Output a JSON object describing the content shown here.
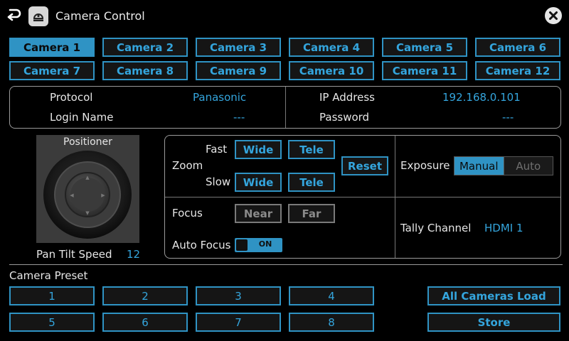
{
  "titlebar": {
    "title": "Camera Control",
    "back_icon": "return-arrow-icon",
    "app_icon": "camera-dome-icon",
    "close_icon": "close-icon"
  },
  "cameras": [
    "Camera 1",
    "Camera 2",
    "Camera 3",
    "Camera 4",
    "Camera 5",
    "Camera 6",
    "Camera 7",
    "Camera 8",
    "Camera 9",
    "Camera 10",
    "Camera 11",
    "Camera 12"
  ],
  "selected_camera": "Camera 1",
  "info": {
    "protocol_label": "Protocol",
    "protocol_value": "Panasonic",
    "ip_label": "IP Address",
    "ip_value": "192.168.0.101",
    "login_label": "Login Name",
    "login_value": "---",
    "password_label": "Password",
    "password_value": "---"
  },
  "positioner": {
    "title": "Positioner",
    "pan_tilt_label": "Pan Tilt Speed",
    "pan_tilt_value": "12"
  },
  "zoom": {
    "label": "Zoom",
    "fast_label": "Fast",
    "slow_label": "Slow",
    "wide": "Wide",
    "tele": "Tele",
    "reset": "Reset"
  },
  "focus": {
    "label": "Focus",
    "near": "Near",
    "far": "Far",
    "auto_label": "Auto Focus",
    "auto_state": "ON"
  },
  "exposure": {
    "label": "Exposure",
    "manual": "Manual",
    "auto": "Auto",
    "selected": "Manual"
  },
  "tally": {
    "label": "Tally Channel",
    "value": "HDMI 1"
  },
  "preset": {
    "label": "Camera Preset",
    "buttons": [
      "1",
      "2",
      "3",
      "4",
      "5",
      "6",
      "7",
      "8"
    ],
    "all_load": "All Cameras Load",
    "store": "Store"
  },
  "colors": {
    "accent": "#2f93c4",
    "background": "#000000",
    "panel": "#3b3b3b"
  }
}
